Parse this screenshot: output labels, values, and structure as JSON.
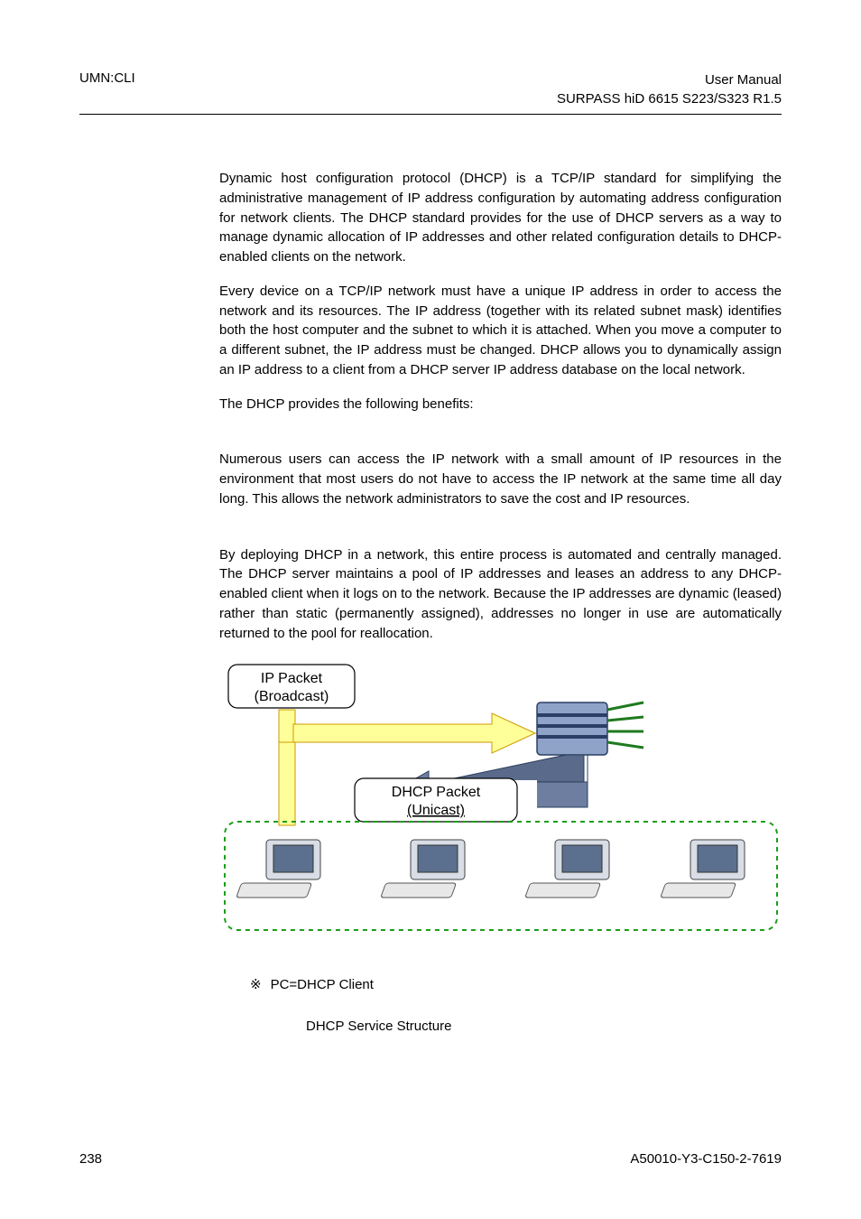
{
  "header": {
    "left": "UMN:CLI",
    "right_line1": "User Manual",
    "right_line2": "SURPASS hiD 6615 S223/S323 R1.5"
  },
  "body": {
    "p1": "Dynamic host configuration protocol (DHCP) is a TCP/IP standard for simplifying the administrative management of IP address configuration by automating address configuration for network clients. The DHCP standard provides for the use of DHCP servers as a way to manage dynamic allocation of IP addresses and other related configuration details to DHCP-enabled clients on the network.",
    "p2": "Every device on a TCP/IP network must have a unique IP address in order to access the network and its resources. The IP address (together with its related subnet mask) identifies both the host computer and the subnet to which it is attached. When you move a computer to a different subnet, the IP address must be changed. DHCP allows you to dynamically assign an IP address to a client from a DHCP server IP address database on the local network.",
    "p3": "The DHCP provides the following benefits:",
    "p4": "Numerous users can access the IP network with a small amount of IP resources in the environment that most users do not have to access the IP network at the same time all day long. This allows the network administrators to save the cost and IP resources.",
    "p5": "By deploying DHCP in a network, this entire process is automated and centrally managed. The DHCP server maintains a pool of IP addresses and leases an address to any DHCP-enabled client when it logs on to the network. Because the IP addresses are dynamic (leased) rather than static (permanently assigned), addresses no longer in use are automatically returned to the pool for reallocation."
  },
  "figure": {
    "ip_packet_label_l1": "IP Packet",
    "ip_packet_label_l2": "(Broadcast)",
    "dhcp_packet_label_l1": "DHCP Packet",
    "dhcp_packet_label_l2": "(Unicast)",
    "legend_symbol": "※",
    "legend_text": "PC=DHCP Client",
    "caption": "DHCP Service Structure"
  },
  "footer": {
    "page_number": "238",
    "doc_id": "A50010-Y3-C150-2-7619"
  }
}
